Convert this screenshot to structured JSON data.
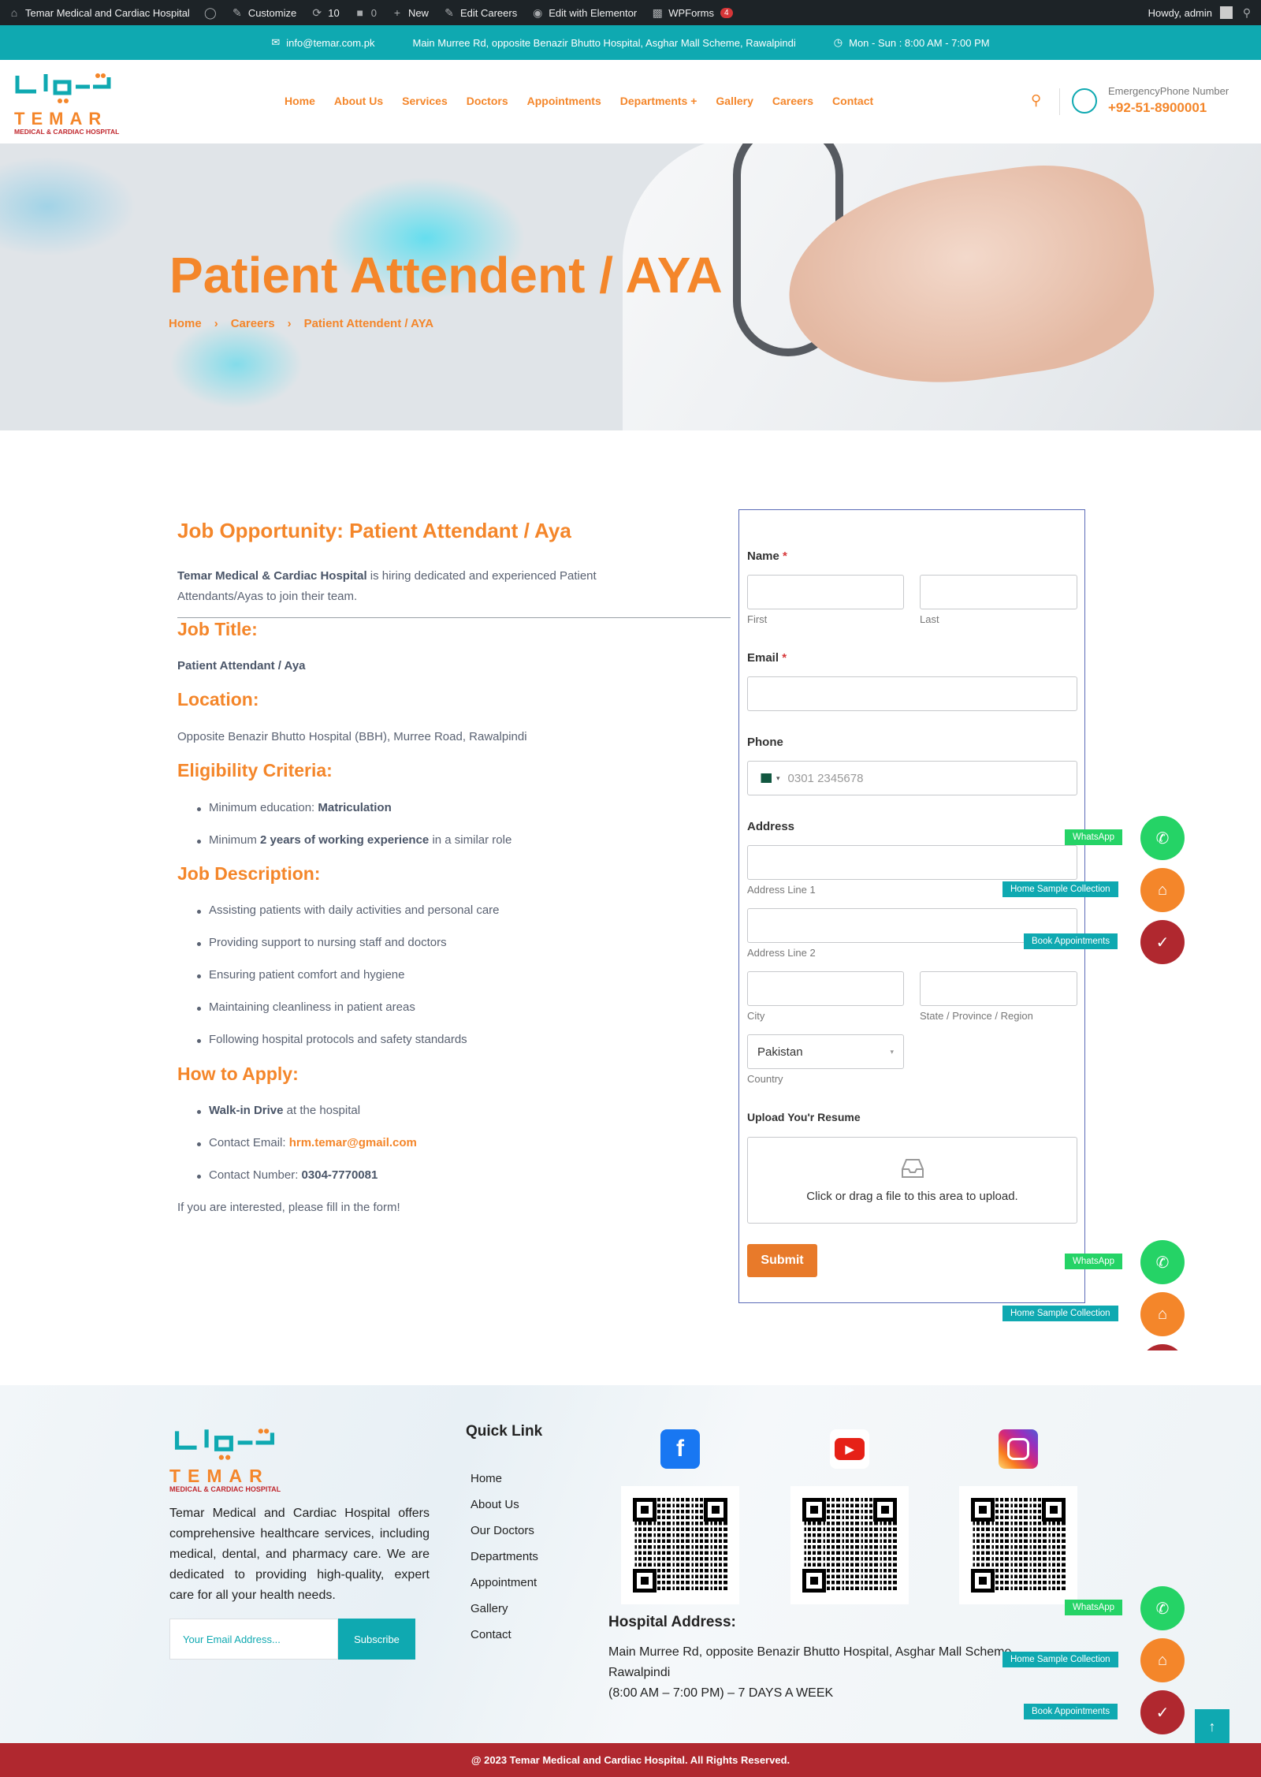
{
  "adminbar": {
    "site_name": "Temar Medical and Cardiac Hospital",
    "customize": "Customize",
    "updates": "10",
    "comments": "0",
    "new": "New",
    "edit_careers": "Edit Careers",
    "edit_elementor": "Edit with Elementor",
    "wpforms": "WPForms",
    "wpforms_badge": "4",
    "howdy": "Howdy, admin"
  },
  "topbar": {
    "email": "info@temar.com.pk",
    "address": "Main Murree Rd, opposite Benazir Bhutto Hospital, Asghar Mall Scheme, Rawalpindi",
    "hours": "Mon - Sun : 8:00 AM - 7:00 PM"
  },
  "header": {
    "logo_text": "TEMAR",
    "logo_sub": "MEDICAL & CARDIAC HOSPITAL",
    "nav": [
      "Home",
      "About Us",
      "Services",
      "Doctors",
      "Appointments",
      "Departments +",
      "Gallery",
      "Careers",
      "Contact"
    ],
    "emergency_label": "EmergencyPhone Number",
    "emergency_number": "+92-51-8900001"
  },
  "hero": {
    "title": "Patient Attendent / AYA",
    "breadcrumb": [
      "Home",
      "Careers",
      "Patient Attendent / AYA"
    ]
  },
  "job": {
    "heading": "Job Opportunity: Patient Attendant / Aya",
    "intro_bold": "Temar Medical & Cardiac Hospital",
    "intro_rest": " is hiring dedicated and experienced Patient Attendants/Ayas to join their team.",
    "title_h": "Job Title:",
    "title_val": "Patient Attendant / Aya",
    "location_h": "Location:",
    "location_val": "Opposite Benazir Bhutto Hospital (BBH), Murree Road, Rawalpindi",
    "elig_h": "Eligibility Criteria:",
    "elig": [
      {
        "pre": "Minimum education: ",
        "bold": "Matriculation",
        "post": ""
      },
      {
        "pre": "Minimum ",
        "bold": "2 years of working experience",
        "post": " in a similar role"
      }
    ],
    "desc_h": "Job Description:",
    "desc": [
      "Assisting patients with daily activities and personal care",
      "Providing support to nursing staff and doctors",
      "Ensuring patient comfort and hygiene",
      "Maintaining cleanliness in patient areas",
      "Following hospital protocols and safety standards"
    ],
    "apply_h": "How to Apply:",
    "apply_walk_bold": "Walk-in Drive",
    "apply_walk_rest": " at the hospital",
    "apply_email_pre": "Contact Email: ",
    "apply_email": "hrm.temar@gmail.com",
    "apply_phone_pre": "Contact Number: ",
    "apply_phone": "0304-7770081",
    "closing": "If you are interested, please fill in the form!"
  },
  "form": {
    "name_label": "Name",
    "req": "*",
    "first": "First",
    "last": "Last",
    "email_label": "Email",
    "phone_label": "Phone",
    "phone_placeholder": "0301 2345678",
    "address_label": "Address",
    "addr1": "Address Line 1",
    "addr2": "Address Line 2",
    "city": "City",
    "state": "State / Province / Region",
    "country_value": "Pakistan",
    "country": "Country",
    "upload_label": "Upload You'r Resume",
    "upload_text": "Click or drag a file to this area to upload.",
    "submit": "Submit"
  },
  "floating": {
    "whatsapp": "WhatsApp",
    "home_sample": "Home Sample Collection",
    "book": "Book Appointments"
  },
  "footer": {
    "logo_text": "TEMAR",
    "logo_sub": "MEDICAL & CARDIAC HOSPITAL",
    "description": "Temar Medical and Cardiac Hospital offers comprehensive healthcare services, including medical, dental, and pharmacy care. We are dedicated to providing high-quality, expert care for all your health needs.",
    "email_placeholder": "Your Email Address...",
    "subscribe": "Subscribe",
    "quick_link_h": "Quick Link",
    "quick_links": [
      "Home",
      "About Us",
      "Our Doctors",
      "Departments",
      "Appointment",
      "Gallery",
      "Contact"
    ],
    "address_h": "Hospital Address:",
    "address_line1": "Main Murree Rd, opposite Benazir Bhutto Hospital, Asghar Mall Scheme,",
    "address_line2": "Rawalpindi",
    "address_line3": "(8:00 AM – 7:00 PM) – 7 DAYS A WEEK",
    "copyright": "@ 2023 Temar Medical and Cardiac Hospital. All Rights Reserved."
  },
  "colors": {
    "accent": "#f4862a",
    "teal": "#0fa9b1",
    "brand_red": "#b0282f",
    "whatsapp": "#25d366"
  }
}
